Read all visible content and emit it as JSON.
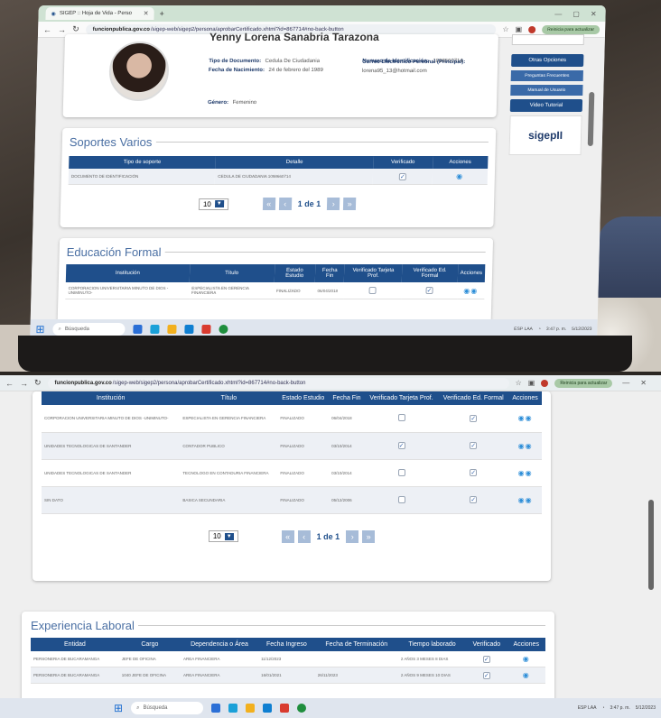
{
  "browser": {
    "tab_title": "SIGEP :: Hoja de Vida - Perso",
    "url_domain": "funcionpublica.gov.co",
    "url_path": "/sigep-web/sigep2/persona/aprobarCertificado.xhtml?id=867714#no-back-button",
    "update_label": "Reinicia para actualizar"
  },
  "profile": {
    "name": "Yenny Lorena Sanabria Tarazona",
    "doc_type_label": "Tipo de Documento:",
    "doc_type_value": "Cedula De Ciudadania",
    "birth_label": "Fecha de Nacimiento:",
    "birth_value": "24 de febrero del 1989",
    "gender_label": "Género:",
    "gender_value": "Femenino",
    "id_label": "Numero de Identificación:",
    "id_value": "1098660714",
    "email_label": "Correo Electrónico Personal (Principal):",
    "email_value": "lorena95_13@hotmail.com"
  },
  "sidebar": {
    "other_options": "Otras Opciones",
    "faq": "Preguntas Frecuentes",
    "manual": "Manual de Usuario",
    "video": "Video Tutorial",
    "logo_text": "sigepII"
  },
  "soportes": {
    "title": "Soportes Varios",
    "headers": [
      "Tipo de soporte",
      "Detalle",
      "Verificado",
      "Acciones"
    ],
    "rows": [
      {
        "tipo": "DOCUMENTO DE IDENTIFICACIÓN",
        "detalle": "CEDULA DE CIUDADANIA 1098660714",
        "verificado": true
      }
    ],
    "page_size": "10",
    "page_text": "1 de 1"
  },
  "educacion": {
    "title": "Educación Formal",
    "headers": [
      "Institución",
      "Título",
      "Estado Estudio",
      "Fecha Fin",
      "Verificado Tarjeta Prof.",
      "Verificado Ed. Formal",
      "Acciones"
    ],
    "rows": [
      {
        "institucion": "CORPORACION UNIVERSITARIA MINUTO DE DIOS -UNIMINUTO-",
        "titulo": "ESPECIALISTA EN GERENCIA FINANCIERA",
        "estado": "FINALIZADO",
        "fecha": "06/04/2018",
        "tarjeta": false,
        "formal": true
      },
      {
        "institucion": "UNIDADES TECNOLOGICAS DE SANTANDER",
        "titulo": "CONTADOR PUBLICO",
        "estado": "FINALIZADO",
        "fecha": "03/10/2014",
        "tarjeta": true,
        "formal": true
      },
      {
        "institucion": "UNIDADES TECNOLOGICAS DE SANTANDER",
        "titulo": "TECNOLOGO EN CONTADURIA FINANCIERA",
        "estado": "FINALIZADO",
        "fecha": "03/10/2014",
        "tarjeta": false,
        "formal": true
      },
      {
        "institucion": "SIN DATO",
        "titulo": "BASICA SECUNDARIA",
        "estado": "FINALIZADO",
        "fecha": "05/12/2006",
        "tarjeta": false,
        "formal": true
      }
    ],
    "page_size": "10",
    "page_text": "1 de 1"
  },
  "experiencia": {
    "title": "Experiencia Laboral",
    "headers": [
      "Entidad",
      "Cargo",
      "Dependencia o Área",
      "Fecha Ingreso",
      "Fecha de Terminación",
      "Tiempo laborado",
      "Verificado",
      "Acciones"
    ],
    "rows": [
      {
        "entidad": "PERSONERIA DE BUCARAMANGA",
        "cargo": "JEFE DE OFICINA",
        "dependencia": "AREA FINANCIERA",
        "ingreso": "11/12/2023",
        "termino": "",
        "tiempo": "2 AÑOS 3 MESES 8 DIAS",
        "verificado": true
      },
      {
        "entidad": "PERSONERIA DE BUCARAMANGA",
        "cargo": "1040 JEFE DE OFICINA",
        "dependencia": "AREA FINANCIERA",
        "ingreso": "16/01/2021",
        "termino": "26/11/2023",
        "tiempo": "2 AÑOS 9 MESES 10 DIAS",
        "verificado": true
      }
    ]
  },
  "taskbar": {
    "search_placeholder": "Búsqueda",
    "lang": "ESP LAA",
    "time": "3:47 p. m.",
    "date": "5/12/2023"
  },
  "colors": {
    "header_blue": "#1f4f8b",
    "title_blue": "#4a6fa3",
    "eye_blue": "#2d8ed8"
  }
}
